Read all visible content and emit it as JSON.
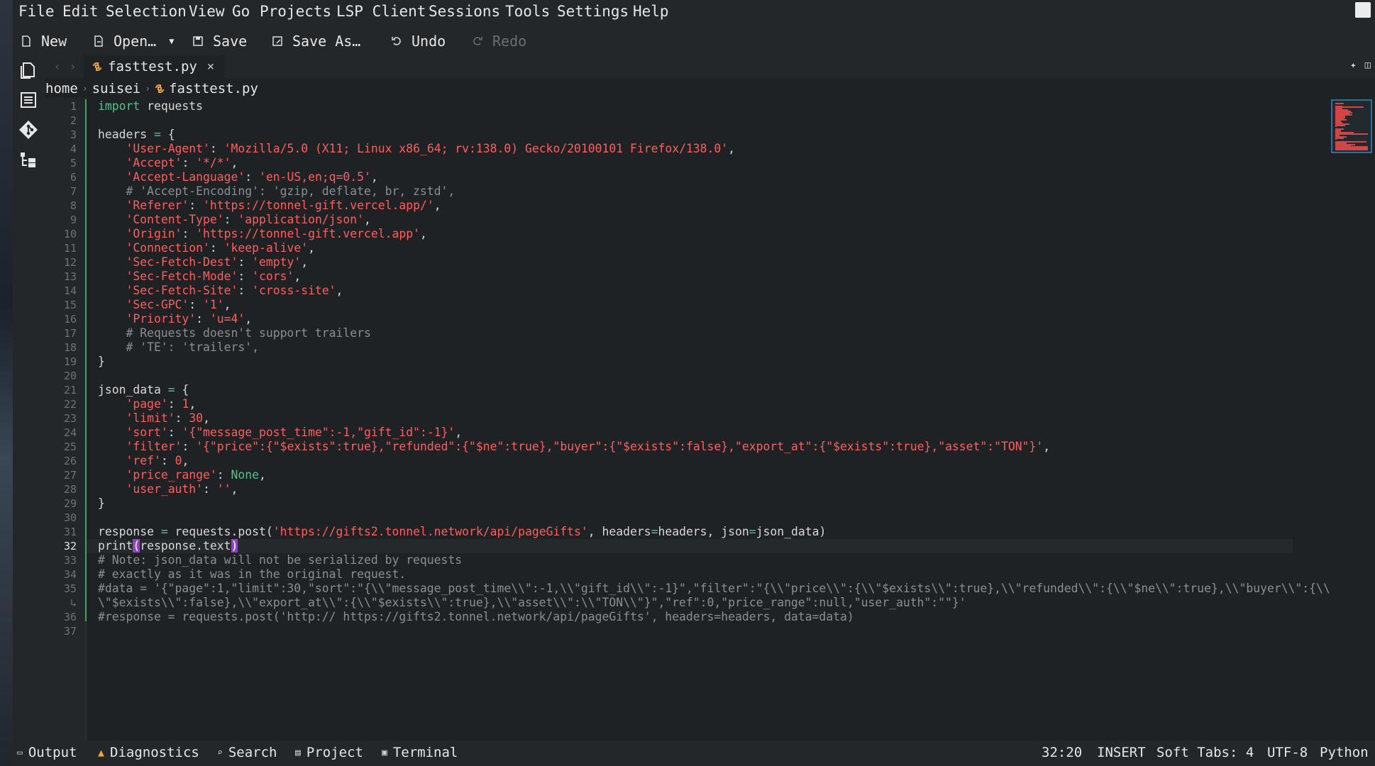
{
  "menubar": {
    "items": [
      "File",
      "Edit",
      "Selection",
      "View",
      "Go",
      "Projects",
      "LSP Client",
      "Sessions",
      "Tools",
      "Settings",
      "Help"
    ]
  },
  "toolbar": {
    "new_label": "New",
    "open_label": "Open…",
    "save_label": "Save",
    "save_as_label": "Save As…",
    "undo_label": "Undo",
    "redo_label": "Redo"
  },
  "tab": {
    "filename": "fasttest.py",
    "close_glyph": "×"
  },
  "breadcrumb": {
    "items": [
      "home",
      "suisei",
      "fasttest.py"
    ]
  },
  "colors": {
    "keyword": "#52c48a",
    "string": "#ff5e5e",
    "comment": "#8a8f94",
    "diff_added": "#3ea55f",
    "bracket_highlight": "#8a47b8",
    "warning": "#f0a33a"
  },
  "editor": {
    "current_line": 32,
    "gutter": [
      "1",
      "2",
      "3",
      "4",
      "5",
      "6",
      "7",
      "8",
      "9",
      "10",
      "11",
      "12",
      "13",
      "14",
      "15",
      "16",
      "17",
      "18",
      "19",
      "20",
      "21",
      "22",
      "23",
      "24",
      "25",
      "26",
      "27",
      "28",
      "29",
      "30",
      "31",
      "32",
      "33",
      "34",
      "35",
      "↳",
      "36",
      "37"
    ],
    "lines": [
      [
        [
          "kw",
          "import"
        ],
        [
          "t",
          " requests"
        ]
      ],
      [],
      [
        [
          "t",
          "headers "
        ],
        [
          "kw",
          "="
        ],
        [
          "t",
          " {"
        ]
      ],
      [
        [
          "t",
          "    "
        ],
        [
          "str",
          "'User-Agent'"
        ],
        [
          "t",
          ": "
        ],
        [
          "str",
          "'Mozilla/5.0 (X11; Linux x86_64; rv:138.0) Gecko/20100101 Firefox/138.0'"
        ],
        [
          "t",
          ","
        ]
      ],
      [
        [
          "t",
          "    "
        ],
        [
          "str",
          "'Accept'"
        ],
        [
          "t",
          ": "
        ],
        [
          "str",
          "'*/*'"
        ],
        [
          "t",
          ","
        ]
      ],
      [
        [
          "t",
          "    "
        ],
        [
          "str",
          "'Accept-Language'"
        ],
        [
          "t",
          ": "
        ],
        [
          "str",
          "'en-US,en;q=0.5'"
        ],
        [
          "t",
          ","
        ]
      ],
      [
        [
          "cm",
          "    # 'Accept-Encoding': 'gzip, deflate, br, zstd',"
        ]
      ],
      [
        [
          "t",
          "    "
        ],
        [
          "str",
          "'Referer'"
        ],
        [
          "t",
          ": "
        ],
        [
          "str",
          "'https://tonnel-gift.vercel.app/'"
        ],
        [
          "t",
          ","
        ]
      ],
      [
        [
          "t",
          "    "
        ],
        [
          "str",
          "'Content-Type'"
        ],
        [
          "t",
          ": "
        ],
        [
          "str",
          "'application/json'"
        ],
        [
          "t",
          ","
        ]
      ],
      [
        [
          "t",
          "    "
        ],
        [
          "str",
          "'Origin'"
        ],
        [
          "t",
          ": "
        ],
        [
          "str",
          "'https://tonnel-gift.vercel.app'"
        ],
        [
          "t",
          ","
        ]
      ],
      [
        [
          "t",
          "    "
        ],
        [
          "str",
          "'Connection'"
        ],
        [
          "t",
          ": "
        ],
        [
          "str",
          "'keep-alive'"
        ],
        [
          "t",
          ","
        ]
      ],
      [
        [
          "t",
          "    "
        ],
        [
          "str",
          "'Sec-Fetch-Dest'"
        ],
        [
          "t",
          ": "
        ],
        [
          "str",
          "'empty'"
        ],
        [
          "t",
          ","
        ]
      ],
      [
        [
          "t",
          "    "
        ],
        [
          "str",
          "'Sec-Fetch-Mode'"
        ],
        [
          "t",
          ": "
        ],
        [
          "str",
          "'cors'"
        ],
        [
          "t",
          ","
        ]
      ],
      [
        [
          "t",
          "    "
        ],
        [
          "str",
          "'Sec-Fetch-Site'"
        ],
        [
          "t",
          ": "
        ],
        [
          "str",
          "'cross-site'"
        ],
        [
          "t",
          ","
        ]
      ],
      [
        [
          "t",
          "    "
        ],
        [
          "str",
          "'Sec-GPC'"
        ],
        [
          "t",
          ": "
        ],
        [
          "str",
          "'1'"
        ],
        [
          "t",
          ","
        ]
      ],
      [
        [
          "t",
          "    "
        ],
        [
          "str",
          "'Priority'"
        ],
        [
          "t",
          ": "
        ],
        [
          "str",
          "'u=4'"
        ],
        [
          "t",
          ","
        ]
      ],
      [
        [
          "cm",
          "    # Requests doesn't support trailers"
        ]
      ],
      [
        [
          "cm",
          "    # 'TE': 'trailers',"
        ]
      ],
      [
        [
          "t",
          "}"
        ]
      ],
      [],
      [
        [
          "t",
          "json_data "
        ],
        [
          "kw",
          "="
        ],
        [
          "t",
          " {"
        ]
      ],
      [
        [
          "t",
          "    "
        ],
        [
          "str",
          "'page'"
        ],
        [
          "t",
          ": "
        ],
        [
          "num",
          "1"
        ],
        [
          "t",
          ","
        ]
      ],
      [
        [
          "t",
          "    "
        ],
        [
          "str",
          "'limit'"
        ],
        [
          "t",
          ": "
        ],
        [
          "num",
          "30"
        ],
        [
          "t",
          ","
        ]
      ],
      [
        [
          "t",
          "    "
        ],
        [
          "str",
          "'sort'"
        ],
        [
          "t",
          ": "
        ],
        [
          "str",
          "'{\"message_post_time\":-1,\"gift_id\":-1}'"
        ],
        [
          "t",
          ","
        ]
      ],
      [
        [
          "t",
          "    "
        ],
        [
          "str",
          "'filter'"
        ],
        [
          "t",
          ": "
        ],
        [
          "str",
          "'{\"price\":{\"$exists\":true},\"refunded\":{\"$ne\":true},\"buyer\":{\"$exists\":false},\"export_at\":{\"$exists\":true},\"asset\":\"TON\"}'"
        ],
        [
          "t",
          ","
        ]
      ],
      [
        [
          "t",
          "    "
        ],
        [
          "str",
          "'ref'"
        ],
        [
          "t",
          ": "
        ],
        [
          "num",
          "0"
        ],
        [
          "t",
          ","
        ]
      ],
      [
        [
          "t",
          "    "
        ],
        [
          "str",
          "'price_range'"
        ],
        [
          "t",
          ": "
        ],
        [
          "kw",
          "None"
        ],
        [
          "t",
          ","
        ]
      ],
      [
        [
          "t",
          "    "
        ],
        [
          "str",
          "'user_auth'"
        ],
        [
          "t",
          ": "
        ],
        [
          "str",
          "''"
        ],
        [
          "t",
          ","
        ]
      ],
      [
        [
          "t",
          "}"
        ]
      ],
      [],
      [
        [
          "t",
          "response "
        ],
        [
          "kw",
          "="
        ],
        [
          "t",
          " requests.post("
        ],
        [
          "str",
          "'https://gifts2.tonnel.network/api/pageGifts'"
        ],
        [
          "t",
          ", headers"
        ],
        [
          "kw",
          "="
        ],
        [
          "t",
          "headers, json"
        ],
        [
          "kw",
          "="
        ],
        [
          "t",
          "json_data)"
        ]
      ],
      [
        [
          "t",
          "print"
        ],
        [
          "br",
          "("
        ],
        [
          "t",
          "response.text"
        ],
        [
          "br",
          ")"
        ]
      ],
      [
        [
          "cm",
          "# Note: json_data will not be serialized by requests"
        ]
      ],
      [
        [
          "cm",
          "# exactly as it was in the original request."
        ]
      ],
      [
        [
          "cm",
          "#data = '{\"page\":1,\"limit\":30,\"sort\":\"{\\\\\"message_post_time\\\\\":-1,\\\\\"gift_id\\\\\":-1}\",\"filter\":\"{\\\\\"price\\\\\":{\\\\\"$exists\\\\\":true},\\\\\"refunded\\\\\":{\\\\\"$ne\\\\\":true},\\\\\"buyer\\\\\":{\\\\"
        ]
      ],
      [
        [
          "cm",
          "\\\"$exists\\\\\":false},\\\\\"export_at\\\\\":{\\\\\"$exists\\\\\":true},\\\\\"asset\\\\\":\\\\\"TON\\\\\"}\",\"ref\":0,\"price_range\":null,\"user_auth\":\"\"}'"
        ]
      ],
      [
        [
          "cm",
          "#response = requests.post('http:// https://gifts2.tonnel.network/api/pageGifts', headers=headers, data=data)"
        ]
      ],
      []
    ]
  },
  "statusbar": {
    "output_label": "Output",
    "diagnostics_label": "Diagnostics",
    "search_label": "Search",
    "project_label": "Project",
    "terminal_label": "Terminal",
    "cursor_pos": "32:20",
    "mode": "INSERT",
    "indent": "Soft Tabs: 4",
    "encoding": "UTF-8",
    "language": "Python"
  },
  "icons": {
    "activity": [
      "documents-icon",
      "symbol-list-icon",
      "git-icon",
      "project-tree-icon"
    ],
    "toolbar": [
      "new-file-icon",
      "open-file-icon",
      "save-icon",
      "save-as-icon",
      "undo-icon",
      "redo-icon"
    ]
  }
}
